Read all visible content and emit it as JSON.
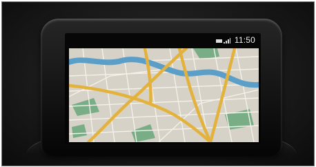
{
  "status_bar": {
    "time": "11:50",
    "icons": [
      "battery-icon",
      "signal-icon"
    ]
  },
  "map": {
    "colors": {
      "land": "#d6d2c8",
      "water": "#5b9fc9",
      "park": "#79ad86",
      "major_road": "#e3b23c",
      "minor_road": "#f4f1ea"
    }
  }
}
